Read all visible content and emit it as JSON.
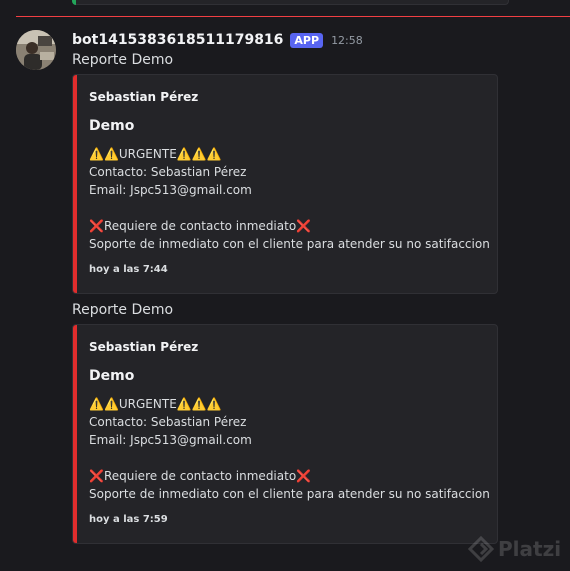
{
  "colors": {
    "background": "#1a1a1e",
    "embed_background": "#242428",
    "embed_accent": "#e02d2d",
    "new_messages_divider": "#f23f43",
    "app_badge": "#5865f2",
    "previous_embed_accent": "#23a55a"
  },
  "message": {
    "author": "bot1415383618511179816",
    "badge": "APP",
    "timestamp": "12:58",
    "avatar_icon": "user-avatar"
  },
  "posts": [
    {
      "text": "Reporte Demo",
      "embed": {
        "author": "Sebastian Pérez",
        "title": "Demo",
        "lines": [
          "⚠️⚠️URGENTE⚠️⚠️⚠️",
          "Contacto: Sebastian Pérez",
          "Email: Jspc513@gmail.com",
          "",
          "❌Requiere de contacto inmediato❌",
          "Soporte de inmediato con el cliente para atender su no satifaccion"
        ],
        "footer": "hoy a las 7:44"
      }
    },
    {
      "text": "Reporte Demo",
      "embed": {
        "author": "Sebastian Pérez",
        "title": "Demo",
        "lines": [
          "⚠️⚠️URGENTE⚠️⚠️⚠️",
          "Contacto: Sebastian Pérez",
          "Email: Jspc513@gmail.com",
          "",
          "❌Requiere de contacto inmediato❌",
          "Soporte de inmediato con el cliente para atender su no satifaccion"
        ],
        "footer": "hoy a las 7:59"
      }
    }
  ],
  "watermark": {
    "text": "Platzi",
    "icon": "platzi-logo-icon"
  }
}
